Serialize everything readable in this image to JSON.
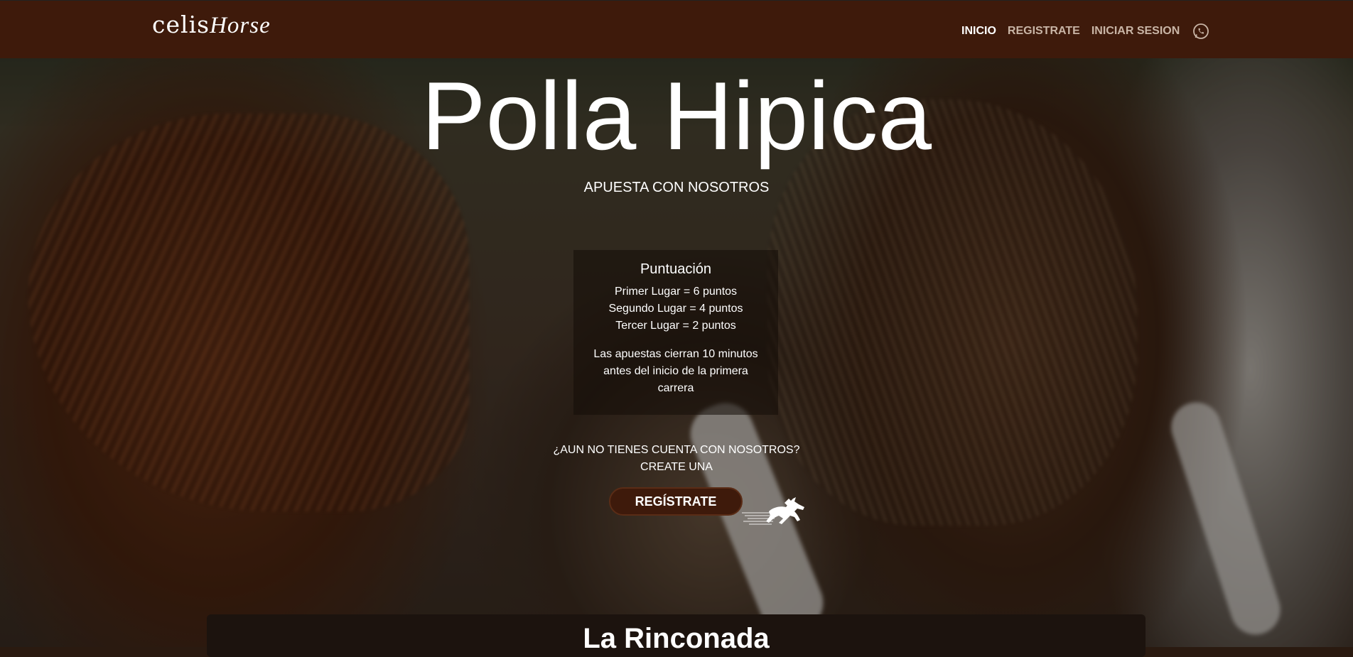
{
  "nav": {
    "logo_text": "celis",
    "logo_text_2": "Horse",
    "links": [
      {
        "label": "INICIO",
        "active": true
      },
      {
        "label": "REGISTRATE",
        "active": false
      },
      {
        "label": "INICIAR SESION",
        "active": false
      }
    ],
    "whatsapp_icon": "whatsapp-icon"
  },
  "hero": {
    "title": "Polla Hipica",
    "subtitle": "APUESTA CON NOSOTROS"
  },
  "scoring": {
    "title": "Puntuación",
    "lines": [
      "Primer Lugar = 6 puntos",
      "Segundo Lugar = 4 puntos",
      "Tercer Lugar = 2 puntos"
    ],
    "note": "Las apuestas cierran 10 minutos antes del inicio de la primera carrera"
  },
  "signup": {
    "question": "¿AUN NO TIENES CUENTA CON NOSOTROS?",
    "cta_text": "CREATE UNA",
    "button_label": "REGÍSTRATE"
  },
  "section": {
    "title": "La Rinconada"
  },
  "colors": {
    "navbar": "#3e1a0b",
    "button": "#3e1a0b"
  }
}
